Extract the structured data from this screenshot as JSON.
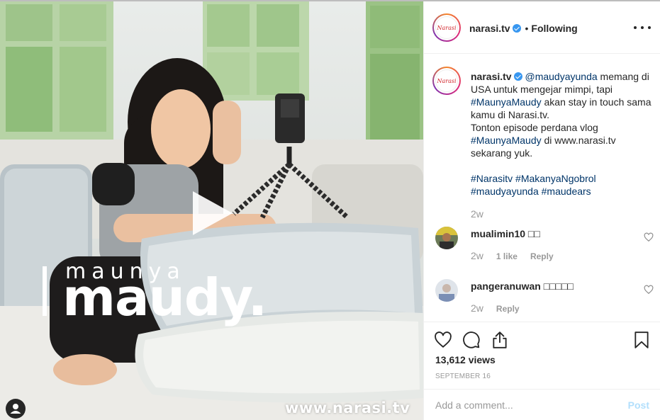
{
  "post": {
    "media": {
      "brand_small": "maunya",
      "brand_big": "maudy.",
      "watermark": "www.narasi.tv",
      "play_icon": "play-icon",
      "tag_icon": "user-tag-icon"
    },
    "header": {
      "avatar_text": "Narasi",
      "username": "narasi.tv",
      "separator": "•",
      "follow_status": "Following",
      "more_icon": "more-horizontal-icon"
    },
    "caption": {
      "avatar_text": "Narasi",
      "username": "narasi.tv",
      "mention": "@maudyayunda",
      "text_1": " memang di USA untuk mengejar mimpi, tapi ",
      "hashtag_1": "#MaunyaMaudy",
      "text_2": " akan stay in touch sama kamu di Narasi.tv.",
      "text_3": "Tonton episode perdana vlog ",
      "hashtag_2": "#MaunyaMaudy",
      "text_4": " di www.narasi.tv sekarang yuk.",
      "hashtags": [
        "#Narasitv",
        "#MakanyaNgobrol",
        "#maudyayunda",
        "#maudears"
      ],
      "time": "2w"
    },
    "comments": [
      {
        "username": "mualimin10",
        "text": "□□",
        "time": "2w",
        "likes": "1 like",
        "reply": "Reply"
      },
      {
        "username": "pangeranuwan",
        "text": "□□□□□",
        "time": "2w",
        "likes": "",
        "reply": "Reply"
      }
    ],
    "actions": {
      "like_icon": "heart-icon",
      "comment_icon": "comment-icon",
      "share_icon": "share-icon",
      "save_icon": "bookmark-icon"
    },
    "views": "13,612 views",
    "date": "SEPTEMBER 16",
    "add_comment": {
      "placeholder": "Add a comment...",
      "post_label": "Post"
    },
    "colors": {
      "link": "#003569",
      "verified": "#3897f0",
      "muted": "#999999",
      "post_disabled": "#b2dffc"
    }
  }
}
